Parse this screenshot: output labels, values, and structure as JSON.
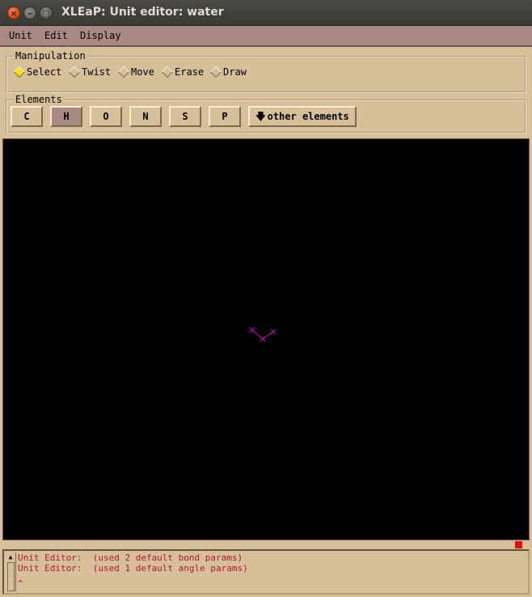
{
  "window": {
    "title": "XLEaP: Unit editor: water",
    "close_glyph": "×",
    "min_glyph": "–",
    "max_glyph": "□"
  },
  "menu": {
    "items": [
      "Unit",
      "Edit",
      "Display"
    ]
  },
  "manipulation": {
    "label": "Manipulation",
    "options": [
      "Select",
      "Twist",
      "Move",
      "Erase",
      "Draw"
    ],
    "selected": "Select"
  },
  "elements": {
    "label": "Elements",
    "buttons": [
      "C",
      "H",
      "O",
      "N",
      "S",
      "P"
    ],
    "active": "H",
    "other": "other elements",
    "other_icon": "down-arrow-icon"
  },
  "colors": {
    "molecule": "#c000c0",
    "selected_indicator": "#e01010",
    "log_text": "#b01838"
  },
  "log": {
    "lines": [
      "Unit Editor:  (used 2 default bond params)",
      "Unit Editor:  (used 1 default angle params)"
    ],
    "prompt": "^"
  }
}
